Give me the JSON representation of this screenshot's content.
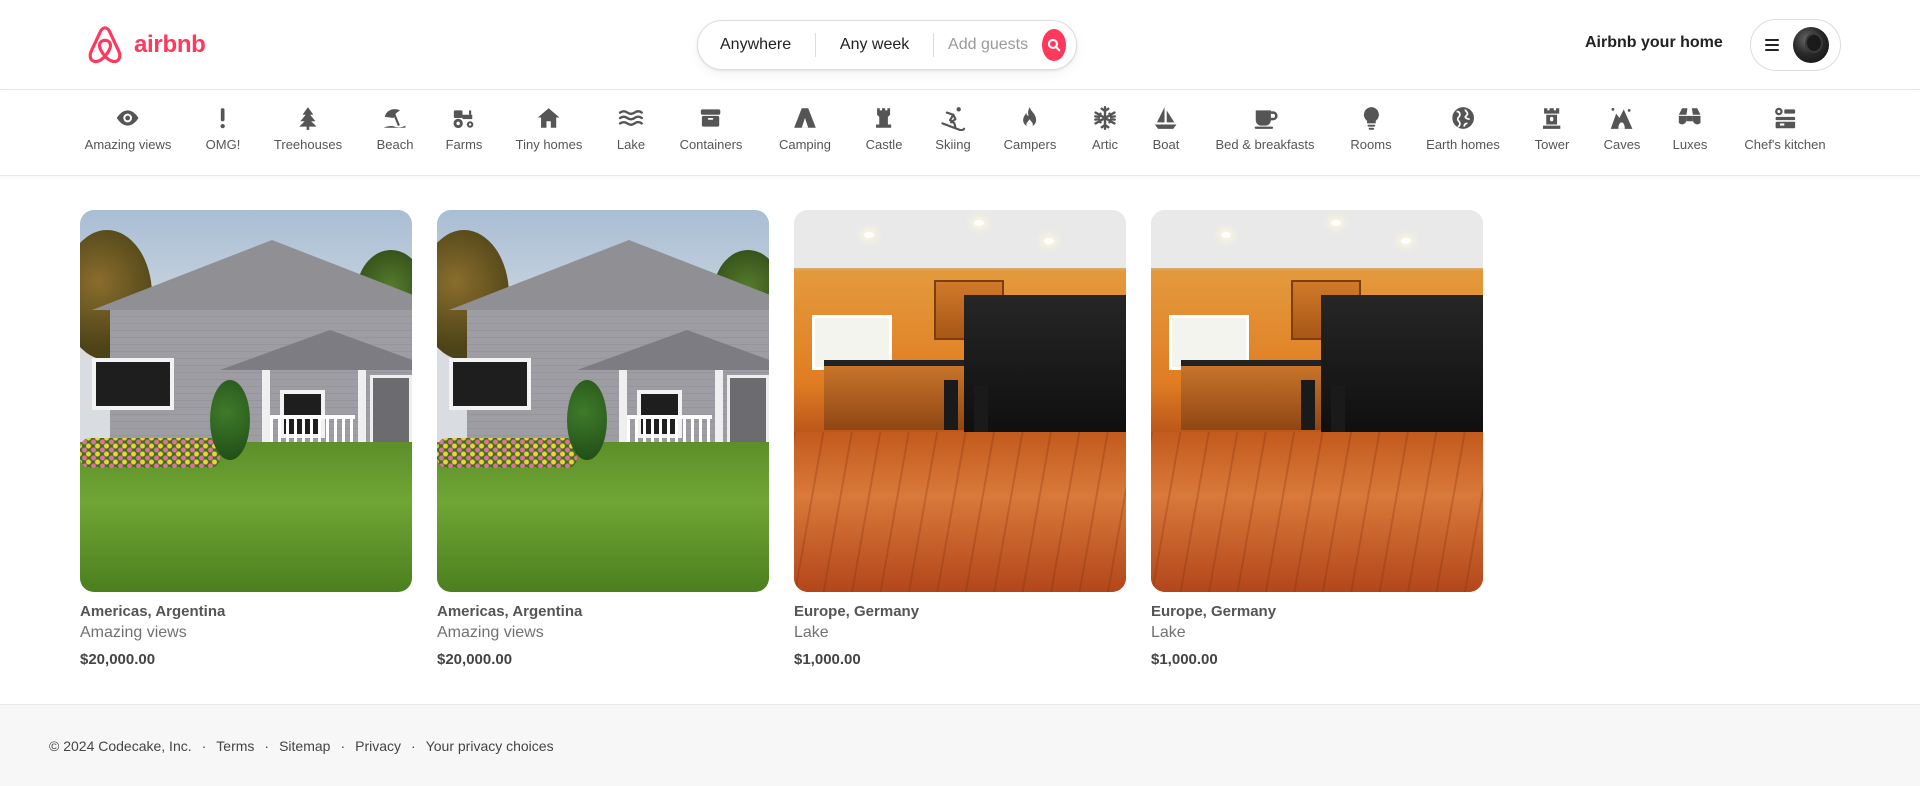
{
  "brand": {
    "name": "airbnb",
    "color": "#FF385C"
  },
  "search": {
    "location": "Anywhere",
    "dates": "Any week",
    "guests_placeholder": "Add guests",
    "button_icon": "search-icon"
  },
  "header": {
    "host_link": "Airbnb your home",
    "menu_icon": "hamburger-icon",
    "avatar": "avatar"
  },
  "categories": [
    {
      "label": "Amazing views",
      "icon": "eye-icon"
    },
    {
      "label": "OMG!",
      "icon": "exclamation-icon"
    },
    {
      "label": "Treehouses",
      "icon": "tree-icon"
    },
    {
      "label": "Beach",
      "icon": "umbrella-beach-icon"
    },
    {
      "label": "Farms",
      "icon": "tractor-icon"
    },
    {
      "label": "Tiny homes",
      "icon": "house-icon"
    },
    {
      "label": "Lake",
      "icon": "water-icon"
    },
    {
      "label": "Containers",
      "icon": "box-icon"
    },
    {
      "label": "Camping",
      "icon": "tent-icon"
    },
    {
      "label": "Castle",
      "icon": "castle-icon"
    },
    {
      "label": "Skiing",
      "icon": "skier-icon"
    },
    {
      "label": "Campers",
      "icon": "fire-icon"
    },
    {
      "label": "Artic",
      "icon": "snowflake-icon"
    },
    {
      "label": "Boat",
      "icon": "sailboat-icon"
    },
    {
      "label": "Bed & breakfasts",
      "icon": "mug-icon"
    },
    {
      "label": "Rooms",
      "icon": "lightbulb-icon"
    },
    {
      "label": "Earth homes",
      "icon": "earth-icon"
    },
    {
      "label": "Tower",
      "icon": "tower-icon"
    },
    {
      "label": "Caves",
      "icon": "cave-icon"
    },
    {
      "label": "Luxes",
      "icon": "gem-icon"
    },
    {
      "label": "Chef's kitchen",
      "icon": "kitchen-icon"
    }
  ],
  "listings": [
    {
      "title": "Americas, Argentina",
      "category": "Amazing views",
      "price": "$20,000.00",
      "image": "house"
    },
    {
      "title": "Americas, Argentina",
      "category": "Amazing views",
      "price": "$20,000.00",
      "image": "house"
    },
    {
      "title": "Europe, Germany",
      "category": "Lake",
      "price": "$1,000.00",
      "image": "kitchen"
    },
    {
      "title": "Europe, Germany",
      "category": "Lake",
      "price": "$1,000.00",
      "image": "kitchen"
    }
  ],
  "footer": {
    "copyright": "© 2024 Codecake, Inc.",
    "links": [
      "Terms",
      "Sitemap",
      "Privacy",
      "Your privacy choices"
    ],
    "separator": "·"
  }
}
